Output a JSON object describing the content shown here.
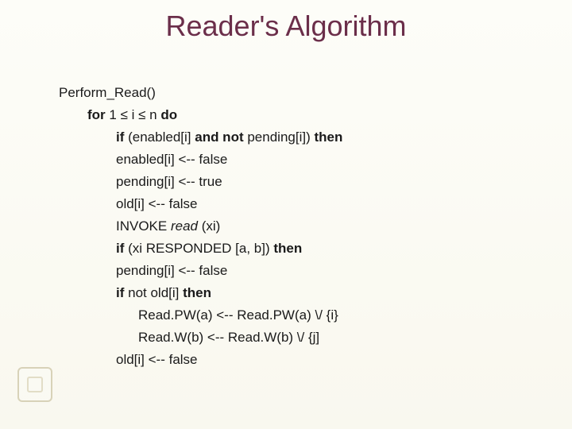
{
  "title": "Reader's Algorithm",
  "lines": {
    "l0": "Perform_Read()",
    "l1_a": "for",
    "l1_b": " 1 ≤ i ≤ n ",
    "l1_c": "do",
    "l2_a": "if",
    "l2_b": " (enabled[i] ",
    "l2_c": "and not",
    "l2_d": " pending[i]) ",
    "l2_e": "then",
    "l3": "enabled[i] <-- false",
    "l4": "pending[i] <-- true",
    "l5": "old[i] <-- false",
    "l6_a": "INVOKE ",
    "l6_b": "read",
    "l6_c": " (xi)",
    "l7_a": "if",
    "l7_b": " (xi RESPONDED [a, b]) ",
    "l7_c": "then",
    "l8": "pending[i] <-- false",
    "l9_a": "if",
    "l9_b": " not old[i] ",
    "l9_c": "then",
    "l10": "Read.PW(a) <-- Read.PW(a) \\/ {i}",
    "l11": "Read.W(b) <-- Read.W(b) \\/ {j]",
    "l12": "old[i] <-- false"
  }
}
